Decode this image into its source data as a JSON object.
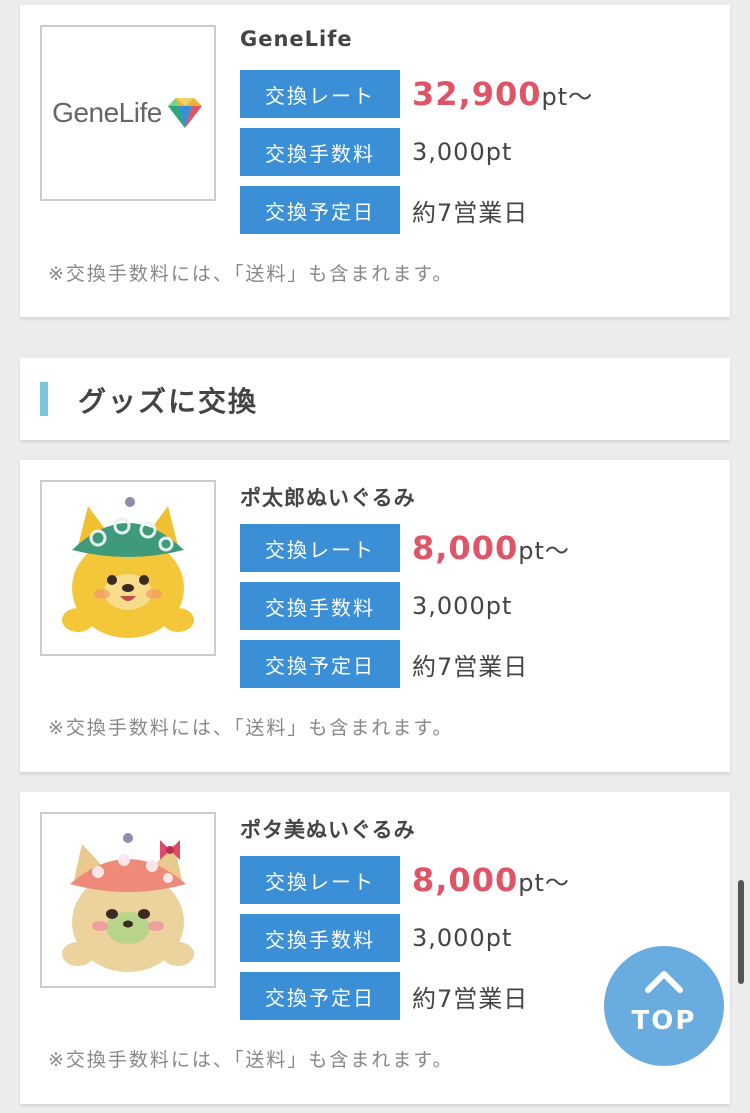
{
  "labels": {
    "rate": "交換レート",
    "fee": "交換手数料",
    "date": "交換予定日"
  },
  "items": [
    {
      "name": "GeneLife",
      "logo_text": "GeneLife",
      "rate_value": "32,900",
      "rate_unit": "pt〜",
      "fee": "3,000pt",
      "date": "約7営業日",
      "note": "※交換手数料には、「送料」も含まれます。"
    },
    {
      "name": "ポ太郎ぬいぐるみ",
      "rate_value": "8,000",
      "rate_unit": "pt〜",
      "fee": "3,000pt",
      "date": "約7営業日",
      "note": "※交換手数料には、「送料」も含まれます。"
    },
    {
      "name": "ポタ美ぬいぐるみ",
      "rate_value": "8,000",
      "rate_unit": "pt〜",
      "fee": "3,000pt",
      "date": "約7営業日",
      "note": "※交換手数料には、「送料」も含まれます。"
    }
  ],
  "section": {
    "heading": "グッズに交換"
  },
  "top_button": {
    "label": "TOP",
    "icon": "chevron-up-icon"
  },
  "colors": {
    "accent": "#3b8fd6",
    "rate": "#e05468",
    "section_bar": "#7cc3dc",
    "top_button": "#62a8de"
  }
}
